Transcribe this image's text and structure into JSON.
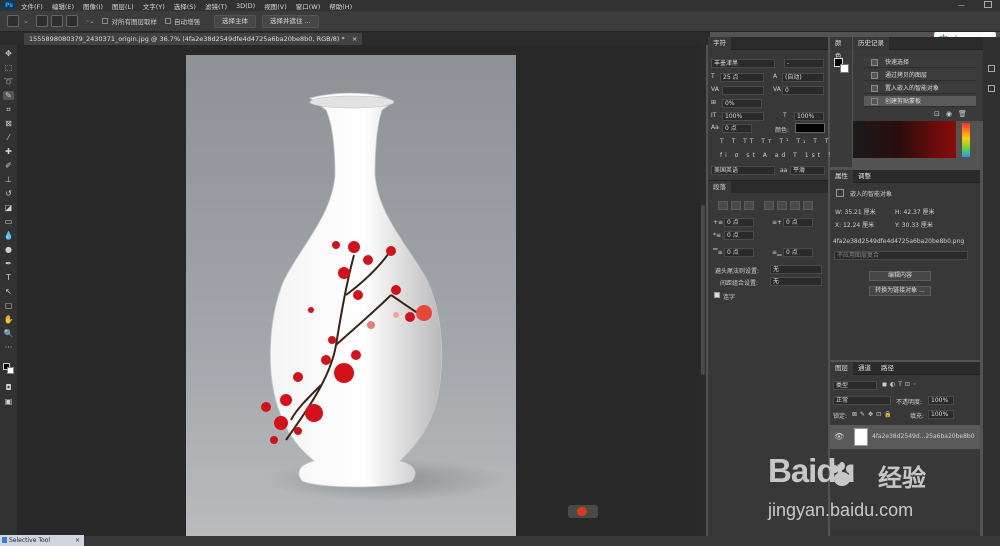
{
  "menu": {
    "items": [
      "文件(F)",
      "编辑(E)",
      "图像(I)",
      "图层(L)",
      "文字(Y)",
      "选择(S)",
      "滤镜(T)",
      "3D(D)",
      "视图(V)",
      "窗口(W)",
      "帮助(H)"
    ]
  },
  "options": {
    "sample_all_layers": "对所有图层取样",
    "auto_enhance": "自动增强",
    "select_subject": "选择主体",
    "select_and_mask": "选择并遮住 ..."
  },
  "document": {
    "tab_title": "1555898080379_2430371_origin.jpg @ 36.7% (4fa2e38d2549dfe4d4725a6ba20be8b0, RGB/8) *",
    "close": "×"
  },
  "character": {
    "tab": "字符",
    "font": "丰墨津黑",
    "font_style": "-",
    "size": "25 点",
    "leading": "(自动)",
    "kerning": "",
    "tracking": "0",
    "scale_pct": "0%",
    "vscale": "100%",
    "hscale": "100%",
    "baseline": "0 点",
    "color_label": "颜色:",
    "language": "美国英语",
    "aa": "平滑",
    "aa_badge": "aa"
  },
  "paragraph": {
    "tab": "段落",
    "indent_left": "0 点",
    "indent_right": "0 点",
    "first_line": "0 点",
    "space_before": "0 点",
    "space_after": "0 点",
    "burasagari_label": "避头尾法则设置:",
    "burasagari_val": "无",
    "mojikumi_label": "间距组合设置:",
    "mojikumi_val": "无",
    "hyphen_label": "连字"
  },
  "color_panel": {
    "tab": "颜色"
  },
  "history": {
    "tab": "历史记录",
    "items": [
      "快速选择",
      "通过拷贝的图层",
      "置入嵌入的智能对象",
      "创建剪贴蒙板"
    ]
  },
  "properties": {
    "tabs": [
      "属性",
      "调整"
    ],
    "type": "嵌入的智能对象",
    "w": "W: 35.21 厘米",
    "h": "H: 42.37 厘米",
    "x": "X: 12.24 厘米",
    "y": "Y: 30.33 厘米",
    "filename": "4fa2e38d2549dfe4d4725a6ba20be8b0.png",
    "no_comp": "不应用图层复合",
    "edit_contents": "编辑内容",
    "convert_linked": "转换为链接对象 ..."
  },
  "layers": {
    "tabs": [
      "图层",
      "通道",
      "路径"
    ],
    "filter_kind": "类型",
    "blend_mode": "正常",
    "opacity_label": "不透明度:",
    "opacity": "100%",
    "lock_label": "锁定:",
    "fill_label": "填充:",
    "fill": "100%",
    "layer_name": "4fa2e38d2549d...25a6ba20be8b0"
  },
  "status": {
    "selective_tool": "Selective Tool",
    "close": "×"
  },
  "ime": {
    "text": "中"
  },
  "watermark": {
    "brand": "Baidu",
    "jingyan": "经验",
    "url": "jingyan.baidu.com"
  }
}
